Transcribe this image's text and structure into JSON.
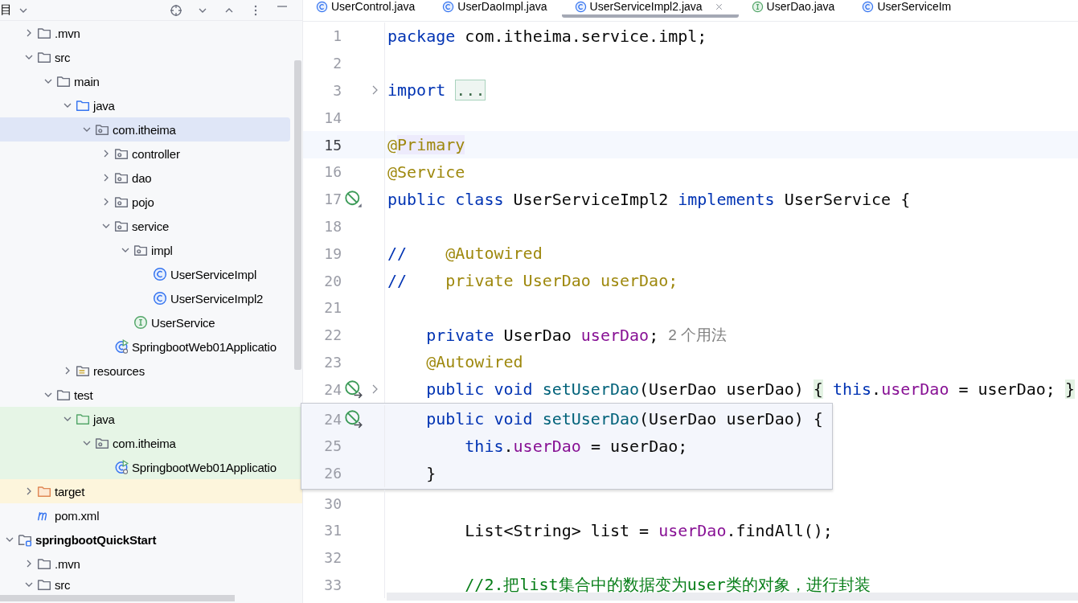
{
  "project_panel": {
    "title": "目",
    "tree": {
      "continued_items": [
        {
          "label": ".mvn",
          "kind": "folder",
          "expanded": false,
          "selected": false
        },
        {
          "label": "src",
          "kind": "folder",
          "expanded": true,
          "selected": false,
          "children": [
            {
              "label": "main",
              "kind": "folder",
              "expanded": true,
              "selected": false,
              "children": [
                {
                  "label": "java",
                  "kind": "source-folder",
                  "expanded": true,
                  "selected": false,
                  "children": [
                    {
                      "label": "com.itheima",
                      "kind": "package",
                      "expanded": true,
                      "selected": true,
                      "children": [
                        {
                          "label": "controller",
                          "kind": "package",
                          "expanded": false,
                          "selected": false
                        },
                        {
                          "label": "dao",
                          "kind": "package",
                          "expanded": false,
                          "selected": false
                        },
                        {
                          "label": "pojo",
                          "kind": "package",
                          "expanded": false,
                          "selected": false
                        },
                        {
                          "label": "service",
                          "kind": "package",
                          "expanded": true,
                          "selected": false,
                          "children": [
                            {
                              "label": "impl",
                              "kind": "package",
                              "expanded": true,
                              "selected": false,
                              "children": [
                                {
                                  "label": "UserServiceImpl",
                                  "kind": "class",
                                  "selected": false
                                },
                                {
                                  "label": "UserServiceImpl2",
                                  "kind": "class",
                                  "selected": false
                                }
                              ]
                            },
                            {
                              "label": "UserService",
                              "kind": "interface",
                              "selected": false
                            }
                          ]
                        },
                        {
                          "label": "SpringbootWeb01Applicatio",
                          "kind": "app",
                          "selected": false
                        }
                      ]
                    }
                  ]
                },
                {
                  "label": "resources",
                  "kind": "resources-folder",
                  "expanded": false,
                  "selected": false
                }
              ]
            },
            {
              "label": "test",
              "kind": "folder",
              "expanded": true,
              "selected": false,
              "children": [
                {
                  "label": "java",
                  "kind": "test-folder",
                  "expanded": true,
                  "selected": false,
                  "color": "#e6f5e6",
                  "children": [
                    {
                      "label": "com.itheima",
                      "kind": "package",
                      "expanded": true,
                      "selected": false,
                      "color": "#e6f5e6",
                      "children": [
                        {
                          "label": "SpringbootWeb01Applicatio",
                          "kind": "app",
                          "selected": false,
                          "color": "#e6f5e6"
                        }
                      ]
                    }
                  ]
                }
              ]
            }
          ]
        },
        {
          "label": "target",
          "kind": "excluded-folder",
          "expanded": false,
          "selected": false,
          "color": "#fdf5dc"
        },
        {
          "label": "pom.xml",
          "kind": "maven",
          "selected": false
        }
      ],
      "items": [
        {
          "label": "springbootQuickStart",
          "kind": "module",
          "expanded": true,
          "selected": false,
          "children": [
            {
              "label": ".mvn",
              "kind": "folder",
              "expanded": false,
              "selected": false
            },
            {
              "label": "src",
              "kind": "folder",
              "expanded": true,
              "selected": false
            }
          ]
        }
      ]
    }
  },
  "tabs": [
    {
      "label": "UserControl.java",
      "kind": "class",
      "selected": false
    },
    {
      "label": "UserDaoImpl.java",
      "kind": "class",
      "selected": false
    },
    {
      "label": "UserServiceImpl2.java",
      "kind": "class",
      "selected": true
    },
    {
      "label": "UserDao.java",
      "kind": "interface",
      "selected": false
    },
    {
      "label": "UserServiceIm",
      "kind": "class",
      "selected": false
    }
  ],
  "editor": {
    "lines": [
      {
        "number": "1",
        "current": false,
        "folded": false,
        "code": [
          {
            "kind": "kw",
            "text": "package"
          },
          {
            "kind": "plain",
            "text": " com.itheima.service.impl;"
          }
        ]
      },
      {
        "number": "2",
        "current": false,
        "folded": false
      },
      {
        "number": "3",
        "current": false,
        "folded": true,
        "code": [
          {
            "kind": "kw",
            "text": "import "
          },
          {
            "kind": "fold",
            "text": "..."
          }
        ]
      },
      {
        "number": "14",
        "current": false,
        "folded": false
      },
      {
        "number": "15",
        "current": true,
        "folded": false,
        "code": [
          {
            "kind": "ann",
            "text": "@"
          },
          {
            "kind": "ann-mark",
            "text": "Primary"
          }
        ]
      },
      {
        "number": "16",
        "current": false,
        "folded": false,
        "code": [
          {
            "kind": "ann",
            "text": "@Service"
          }
        ]
      },
      {
        "number": "17",
        "current": false,
        "folded": false,
        "gutter_icon": {
          "kind": "bean"
        },
        "code": [
          {
            "kind": "kw",
            "text": "public class"
          },
          {
            "kind": "plain",
            "text": " UserServiceImpl2 "
          },
          {
            "kind": "kw",
            "text": "implements"
          },
          {
            "kind": "plain",
            "text": " UserService {"
          }
        ]
      },
      {
        "number": "18",
        "current": false,
        "folded": false
      },
      {
        "number": "19",
        "current": false,
        "folded": false,
        "code": [
          {
            "kind": "kw",
            "text": "//"
          },
          {
            "kind": "ann",
            "text": "    @Autowired"
          }
        ]
      },
      {
        "number": "20",
        "current": false,
        "folded": false,
        "code": [
          {
            "kind": "kw",
            "text": "//"
          },
          {
            "kind": "ann",
            "text": "    private UserDao userDao;"
          }
        ]
      },
      {
        "number": "21",
        "current": false,
        "folded": false
      },
      {
        "number": "22",
        "current": false,
        "folded": false,
        "hint": "2 个用法",
        "code": [
          {
            "kind": "kw",
            "text": "    private"
          },
          {
            "kind": "plain",
            "text": " UserDao "
          },
          {
            "kind": "field",
            "text": "userDao"
          },
          {
            "kind": "plain",
            "text": ";"
          }
        ]
      },
      {
        "number": "23",
        "current": false,
        "folded": false,
        "code": [
          {
            "kind": "ann",
            "text": "    @Autowired"
          }
        ]
      },
      {
        "number": "24",
        "current": false,
        "folded": true,
        "gutter_icon": {
          "kind": "bean-link"
        },
        "code": [
          {
            "kind": "kw",
            "text": "    public void "
          },
          {
            "kind": "method",
            "text": "setUserDao"
          },
          {
            "kind": "plain",
            "text": "(UserDao userDao) "
          },
          {
            "kind": "match",
            "text": "{"
          },
          {
            "kind": "kw",
            "text": " this"
          },
          {
            "kind": "plain",
            "text": "."
          },
          {
            "kind": "field",
            "text": "userDao"
          },
          {
            "kind": "plain",
            "text": " = userDao; "
          },
          {
            "kind": "match",
            "text": "}"
          }
        ]
      }
    ],
    "popup": {
      "lines": [
        {
          "number": "24",
          "current": false,
          "folded": false,
          "gutter_icon": {
            "kind": "bean-link"
          },
          "code": [
            {
              "kind": "kw",
              "text": "    public void "
            },
            {
              "kind": "method",
              "text": "setUserDao"
            },
            {
              "kind": "plain",
              "text": "(UserDao userDao) {"
            }
          ]
        },
        {
          "number": "25",
          "current": false,
          "folded": false,
          "code": [
            {
              "kind": "kw",
              "text": "        this"
            },
            {
              "kind": "plain",
              "text": "."
            },
            {
              "kind": "field",
              "text": "userDao"
            },
            {
              "kind": "plain",
              "text": " = userDao;"
            }
          ]
        },
        {
          "number": "26",
          "current": false,
          "folded": false,
          "code": [
            {
              "kind": "plain",
              "text": "    }"
            }
          ]
        }
      ]
    },
    "lines_after": [
      {
        "number": "30",
        "current": false,
        "folded": false
      },
      {
        "number": "31",
        "current": false,
        "folded": false,
        "code": [
          {
            "kind": "plain",
            "text": "        List<String> list = "
          },
          {
            "kind": "field",
            "text": "userDao"
          },
          {
            "kind": "plain",
            "text": ".findAll();"
          }
        ]
      },
      {
        "number": "32",
        "current": false,
        "folded": false
      },
      {
        "number": "33",
        "current": false,
        "folded": false,
        "code": [
          {
            "kind": "comment",
            "text": "        //2.把list集合中的数据变为user类的对象，进行封装"
          }
        ]
      }
    ]
  }
}
